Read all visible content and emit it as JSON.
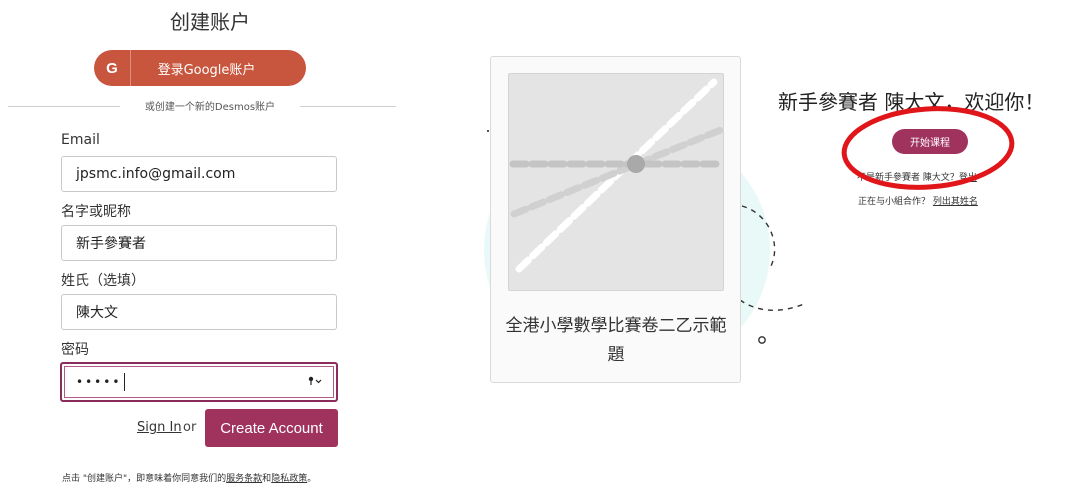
{
  "signup": {
    "title": "创建账户",
    "google_button": {
      "icon_letter": "G",
      "label": "登录Google账户",
      "color": "#c8553d"
    },
    "divider_text": "或创建一个新的Desmos账户",
    "fields": {
      "email": {
        "label": "Email",
        "value": "jpsmc.info@gmail.com"
      },
      "name": {
        "label": "名字或昵称",
        "value": "新手參賽者"
      },
      "surname": {
        "label": "姓氏（选填）",
        "value": "陳大文"
      },
      "password": {
        "label": "密码",
        "value": "•••••",
        "icon": "key-dropdown-icon"
      }
    },
    "signin_link": "Sign In",
    "or_text": "or",
    "create_button": "Create Account",
    "terms": {
      "prefix": "点击 \"创建账户\"，即意味着你同意我们的",
      "service_terms": "服务条款",
      "and": "和",
      "privacy_policy": "隐私政策",
      "suffix": "。"
    },
    "accent_color": "#a0325e"
  },
  "class_card": {
    "title": "全港小學數學比賽卷二乙示範題",
    "thumbnail_icon": "graph-lines-icon"
  },
  "welcome": {
    "greeting": "新手參賽者 陳大文，欢迎你！",
    "start_button": "开始课程",
    "not_me_prefix": "不是新手參賽者 陳大文？",
    "sign_out": "登出",
    "group_prefix": "正在与小組合作？",
    "list_names": "列出其姓名",
    "highlight_color": "#e0161b"
  }
}
